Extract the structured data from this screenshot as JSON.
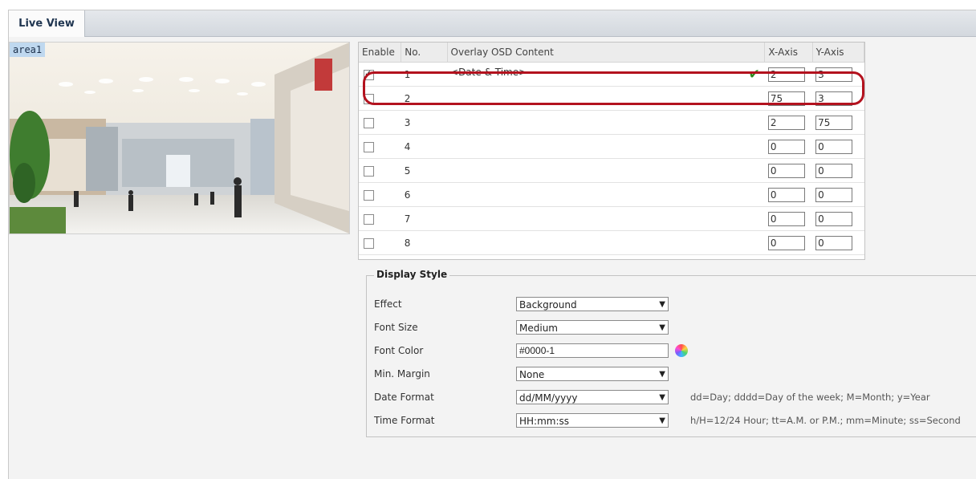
{
  "tab": {
    "label": "Live View"
  },
  "preview": {
    "area_label": "area1"
  },
  "osd_table": {
    "headers": {
      "enable": "Enable",
      "no": "No.",
      "content": "Overlay OSD Content",
      "x": "X-Axis",
      "y": "Y-Axis"
    },
    "rows": [
      {
        "enabled": true,
        "no": "1",
        "content": "<Date & Time>",
        "x": "2",
        "y": "3"
      },
      {
        "enabled": false,
        "no": "2",
        "content": "",
        "x": "75",
        "y": "3"
      },
      {
        "enabled": false,
        "no": "3",
        "content": "",
        "x": "2",
        "y": "75"
      },
      {
        "enabled": false,
        "no": "4",
        "content": "",
        "x": "0",
        "y": "0"
      },
      {
        "enabled": false,
        "no": "5",
        "content": "",
        "x": "0",
        "y": "0"
      },
      {
        "enabled": false,
        "no": "6",
        "content": "",
        "x": "0",
        "y": "0"
      },
      {
        "enabled": false,
        "no": "7",
        "content": "",
        "x": "0",
        "y": "0"
      },
      {
        "enabled": false,
        "no": "8",
        "content": "",
        "x": "0",
        "y": "0"
      }
    ]
  },
  "display_style": {
    "title": "Display Style",
    "effect": {
      "label": "Effect",
      "value": "Background"
    },
    "font_size": {
      "label": "Font Size",
      "value": "Medium"
    },
    "font_color": {
      "label": "Font Color",
      "value": "#0000-1"
    },
    "min_margin": {
      "label": "Min. Margin",
      "value": "None"
    },
    "date_format": {
      "label": "Date Format",
      "value": "dd/MM/yyyy",
      "hint": "dd=Day; dddd=Day of the week; M=Month; y=Year"
    },
    "time_format": {
      "label": "Time Format",
      "value": "HH:mm:ss",
      "hint": "h/H=12/24 Hour; tt=A.M. or P.M.; mm=Minute; ss=Second"
    }
  },
  "colors": {
    "highlight": "#b3121e",
    "ok": "#2e8b1f",
    "tab_text": "#1f3550"
  },
  "icons": {
    "ok": "checkmark-icon",
    "color_picker": "color-wheel-icon",
    "dropdown": "chevron-down-icon"
  }
}
